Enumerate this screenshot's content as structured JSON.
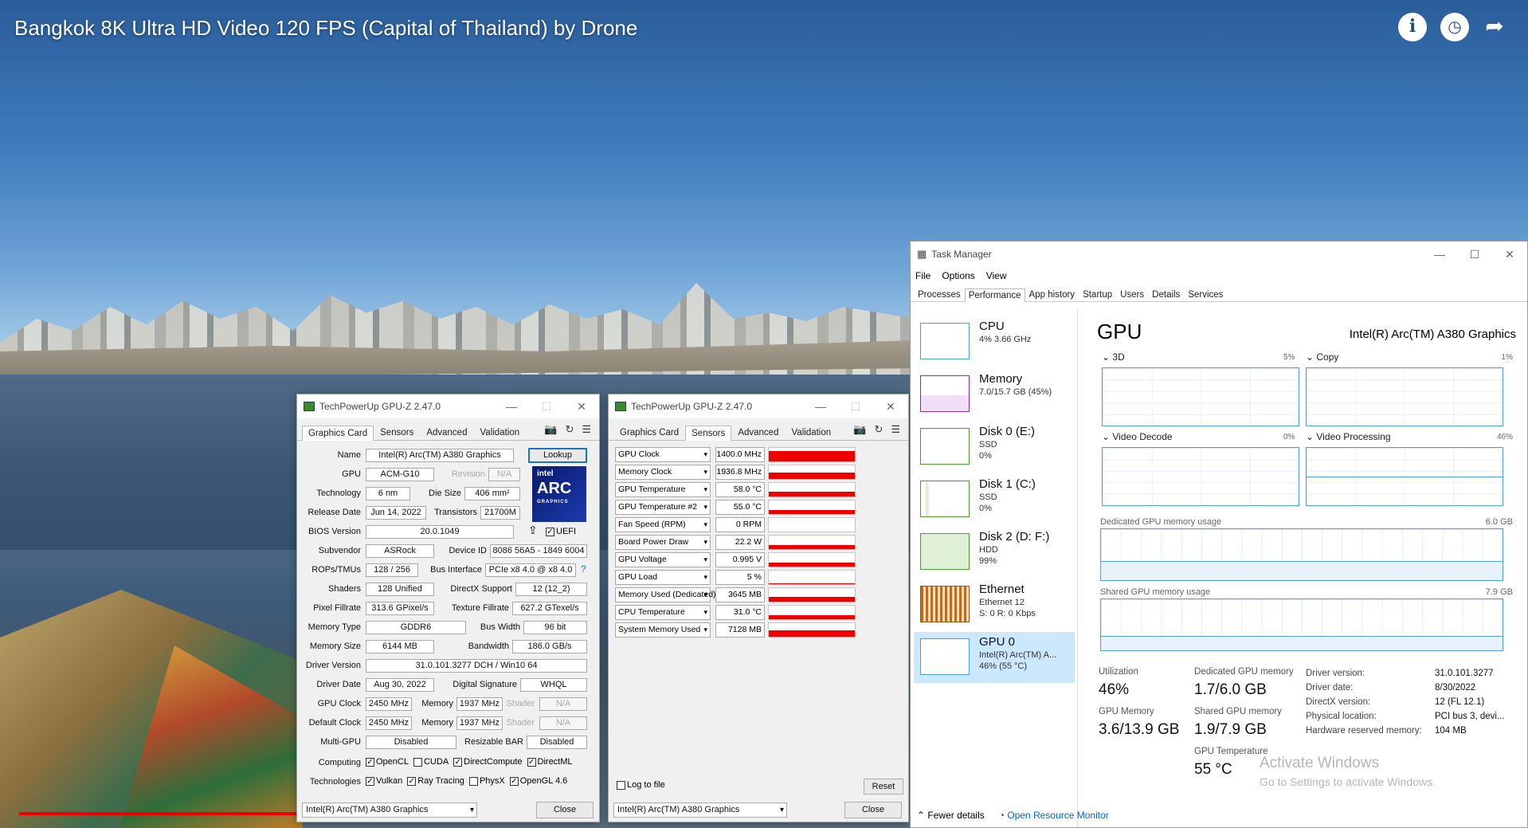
{
  "video": {
    "title": "Bangkok 8K Ultra HD Video 120 FPS (Capital of Thailand) by Drone",
    "icons": [
      "info-icon",
      "clock-icon",
      "share-icon"
    ]
  },
  "gpuz_a": {
    "title": "TechPowerUp GPU-Z 2.47.0",
    "tabs": [
      "Graphics Card",
      "Sensors",
      "Advanced",
      "Validation"
    ],
    "active_tab": "Graphics Card",
    "lookup": "Lookup",
    "logo_text": "intel ARC GRAPHICS",
    "fields": {
      "name_l": "Name",
      "name": "Intel(R) Arc(TM) A380 Graphics",
      "gpu_l": "GPU",
      "gpu": "ACM-G10",
      "revision_l": "Revision",
      "revision": "N/A",
      "tech_l": "Technology",
      "tech": "6 nm",
      "die_l": "Die Size",
      "die": "406 mm²",
      "release_l": "Release Date",
      "release": "Jun 14, 2022",
      "trans_l": "Transistors",
      "trans": "21700M",
      "bios_l": "BIOS Version",
      "bios": "20.0.1049",
      "uefi": "UEFI",
      "subv_l": "Subvendor",
      "subv": "ASRock",
      "devid_l": "Device ID",
      "devid": "8086 56A5 - 1849 6004",
      "rops_l": "ROPs/TMUs",
      "rops": "128 / 256",
      "bus_l": "Bus Interface",
      "bus": "PCIe x8 4.0 @ x8 4.0",
      "bus_q": "?",
      "shaders_l": "Shaders",
      "shaders": "128 Unified",
      "dx_l": "DirectX Support",
      "dx": "12 (12_2)",
      "pix_l": "Pixel Fillrate",
      "pix": "313.6 GPixel/s",
      "tex_l": "Texture Fillrate",
      "tex": "627.2 GTexel/s",
      "mtype_l": "Memory Type",
      "mtype": "GDDR6",
      "bw_l": "Bus Width",
      "bw": "96 bit",
      "msize_l": "Memory Size",
      "msize": "6144 MB",
      "band_l": "Bandwidth",
      "band": "186.0 GB/s",
      "drv_l": "Driver Version",
      "drv": "31.0.101.3277 DCH / Win10 64",
      "ddate_l": "Driver Date",
      "ddate": "Aug 30, 2022",
      "dsig_l": "Digital Signature",
      "dsig": "WHQL",
      "gclk_l": "GPU Clock",
      "gclk": "2450 MHz",
      "mem_l": "Memory",
      "gmem": "1937 MHz",
      "shader_l": "Shader",
      "shader": "N/A",
      "dclk_l": "Default Clock",
      "dclk": "2450 MHz",
      "dmem": "1937 MHz",
      "dshader": "N/A",
      "multi_l": "Multi-GPU",
      "multi": "Disabled",
      "rbar_l": "Resizable BAR",
      "rbar": "Disabled",
      "comp_l": "Computing",
      "tech2_l": "Technologies"
    },
    "computing": [
      {
        "label": "OpenCL",
        "on": true
      },
      {
        "label": "CUDA",
        "on": false
      },
      {
        "label": "DirectCompute",
        "on": true
      },
      {
        "label": "DirectML",
        "on": true
      }
    ],
    "technologies": [
      {
        "label": "Vulkan",
        "on": true
      },
      {
        "label": "Ray Tracing",
        "on": true
      },
      {
        "label": "PhysX",
        "on": false
      },
      {
        "label": "OpenGL 4.6",
        "on": true
      }
    ],
    "select": "Intel(R) Arc(TM) A380 Graphics",
    "close": "Close"
  },
  "gpuz_b": {
    "title": "TechPowerUp GPU-Z 2.47.0",
    "tabs": [
      "Graphics Card",
      "Sensors",
      "Advanced",
      "Validation"
    ],
    "active_tab": "Sensors",
    "sensors": [
      {
        "name": "GPU Clock",
        "value": "1400.0 MHz",
        "level": 0.75
      },
      {
        "name": "Memory Clock",
        "value": "1936.8 MHz",
        "level": 0.5
      },
      {
        "name": "GPU Temperature",
        "value": "58.0 °C",
        "level": 0.35
      },
      {
        "name": "GPU Temperature #2",
        "value": "55.0 °C",
        "level": 0.3
      },
      {
        "name": "Fan Speed (RPM)",
        "value": "0 RPM",
        "level": 0.0
      },
      {
        "name": "Board Power Draw",
        "value": "22.2 W",
        "level": 0.3
      },
      {
        "name": "GPU Voltage",
        "value": "0.995 V",
        "level": 0.3
      },
      {
        "name": "GPU Load",
        "value": "5 %",
        "level": 0.05
      },
      {
        "name": "Memory Used (Dedicated)",
        "value": "3645 MB",
        "level": 0.35
      },
      {
        "name": "CPU Temperature",
        "value": "31.0 °C",
        "level": 0.3
      },
      {
        "name": "System Memory Used",
        "value": "7128 MB",
        "level": 0.45
      }
    ],
    "log": "Log to file",
    "reset": "Reset",
    "select": "Intel(R) Arc(TM) A380 Graphics",
    "close": "Close"
  },
  "taskmgr": {
    "title": "Task Manager",
    "menu": [
      "File",
      "Options",
      "View"
    ],
    "tabs": [
      "Processes",
      "Performance",
      "App history",
      "Startup",
      "Users",
      "Details",
      "Services"
    ],
    "active_tab": "Performance",
    "side": [
      {
        "title": "CPU",
        "l1": "4% 3.66 GHz",
        "l2": ""
      },
      {
        "title": "Memory",
        "l1": "7.0/15.7 GB (45%)",
        "l2": ""
      },
      {
        "title": "Disk 0 (E:)",
        "l1": "SSD",
        "l2": "0%"
      },
      {
        "title": "Disk 1 (C:)",
        "l1": "SSD",
        "l2": "0%"
      },
      {
        "title": "Disk 2 (D: F:)",
        "l1": "HDD",
        "l2": "99%"
      },
      {
        "title": "Ethernet",
        "l1": "Ethernet 12",
        "l2": "S: 0 R: 0 Kbps"
      },
      {
        "title": "GPU 0",
        "l1": "Intel(R) Arc(TM) A...",
        "l2": "46% (55 °C)"
      }
    ],
    "gpu": {
      "heading": "GPU",
      "model": "Intel(R) Arc(TM) A380 Graphics",
      "engines": [
        {
          "name": "3D",
          "pct": "5%"
        },
        {
          "name": "Copy",
          "pct": "1%"
        },
        {
          "name": "Video Decode",
          "pct": "0%"
        },
        {
          "name": "Video Processing",
          "pct": "46%"
        }
      ],
      "dedicated_label": "Dedicated GPU memory usage",
      "dedicated_max": "6.0 GB",
      "shared_label": "Shared GPU memory usage",
      "shared_max": "7.9 GB",
      "util_l": "Utilization",
      "util": "46%",
      "ded_l": "Dedicated GPU memory",
      "ded": "1.7/6.0 GB",
      "gmem_l": "GPU Memory",
      "gmem": "3.6/13.9 GB",
      "sh_l": "Shared GPU memory",
      "sh": "1.9/7.9 GB",
      "temp_l": "GPU Temperature",
      "temp": "55 °C",
      "kv": [
        {
          "k": "Driver version:",
          "v": "31.0.101.3277"
        },
        {
          "k": "Driver date:",
          "v": "8/30/2022"
        },
        {
          "k": "DirectX version:",
          "v": "12 (FL 12.1)"
        },
        {
          "k": "Physical location:",
          "v": "PCI bus 3, devi..."
        },
        {
          "k": "Hardware reserved memory:",
          "v": "104 MB"
        }
      ]
    },
    "activate1": "Activate Windows",
    "activate2": "Go to Settings to activate Windows.",
    "fewer": "Fewer details",
    "resmon": "Open Resource Monitor"
  }
}
